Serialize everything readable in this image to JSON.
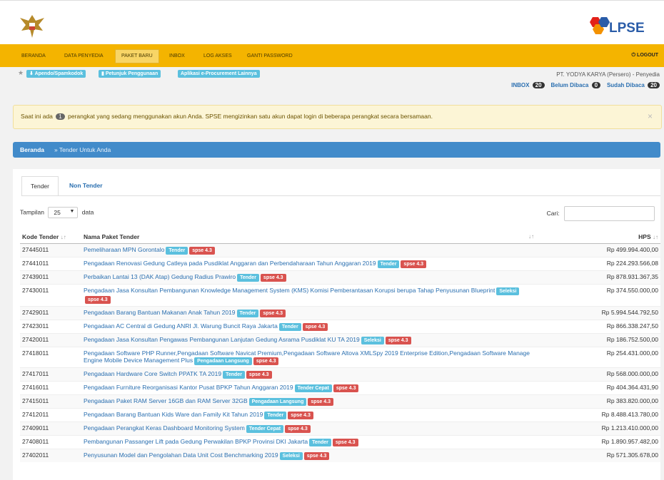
{
  "nav": {
    "items": [
      "Beranda",
      "Data Penyedia",
      "Paket Baru",
      "Inbox",
      "Log Akses",
      "Ganti Password"
    ],
    "logout": "LOGOUT"
  },
  "logo": {
    "text": "LPSE"
  },
  "toolbar": {
    "star": "★",
    "links": [
      "Apendo/Spamkodok",
      "Petunjuk Penggunaan",
      "Aplikasi e-Procurement Lainnya"
    ]
  },
  "user": {
    "company": "PT. YODYA KARYA (Persero) - Penyedia",
    "inbox_label": "INBOX",
    "inbox_count": "20",
    "unread_label": "Belum Dibaca",
    "unread_count": "0",
    "read_label": "Sudah Dibaca",
    "read_count": "20"
  },
  "alert": {
    "prefix": "Saat ini ada",
    "count": "1",
    "suffix": "perangkat yang sedang menggunakan akun Anda. SPSE mengizinkan satu akun dapat login di beberapa perangkat secara bersamaan.",
    "close": "×"
  },
  "breadcrumb": {
    "home": "Beranda",
    "current": "» Tender Untuk Anda"
  },
  "tabs": [
    "Tender",
    "Non Tender"
  ],
  "list": {
    "show_label": "Tampilan",
    "page_size": "25",
    "data_label": "data",
    "search_label": "Cari:",
    "search_value": ""
  },
  "table": {
    "columns": [
      "Kode Tender",
      "Nama Paket Tender",
      "HPS"
    ],
    "sort_glyph": "↓↑",
    "rows": [
      {
        "code": "27445011",
        "name": "Pemeliharaan MPN Gorontalo",
        "type": "Tender",
        "ver": "spse 4.3",
        "hps": "Rp 499.994.400,00"
      },
      {
        "code": "27441011",
        "name": "Pengadaan Renovasi Gedung Catleya pada Pusdiklat Anggaran dan Perbendaharaan Tahun Anggaran 2019",
        "type": "Tender",
        "ver": "spse 4.3",
        "hps": "Rp 224.293.566,08"
      },
      {
        "code": "27439011",
        "name": "Perbaikan Lantai 13 (DAK Atap) Gedung Radius Prawiro",
        "type": "Tender",
        "ver": "spse 4.3",
        "hps": "Rp 878.931.367,35"
      },
      {
        "code": "27430011",
        "name": "Pengadaan Jasa Konsultan Pembangunan Knowledge Management System (KMS) Komisi Pemberantasan Korupsi berupa Tahap Penyusunan Blueprint",
        "type": "Seleksi",
        "ver": "spse 4.3",
        "hps": "Rp 374.550.000,00"
      },
      {
        "code": "27429011",
        "name": "Pengadaan Barang Bantuan Makanan Anak Tahun 2019",
        "type": "Tender",
        "ver": "spse 4.3",
        "hps": "Rp 5.994.544.792,50"
      },
      {
        "code": "27423011",
        "name": "Pengadaan AC Central di Gedung ANRI Jl. Warung Buncit Raya Jakarta",
        "type": "Tender",
        "ver": "spse 4.3",
        "hps": "Rp 866.338.247,50"
      },
      {
        "code": "27420011",
        "name": "Pengadaan Jasa Konsultan Pengawas Pembangunan Lanjutan Gedung Asrama Pusdiklat KU TA 2019",
        "type": "Seleksi",
        "ver": "spse 4.3",
        "hps": "Rp 186.752.500,00"
      },
      {
        "code": "27418011",
        "name": "Pengadaan Software PHP Runner,Pengadaan Software Navicat Premium,Pengadaan Software Altova XMLSpy 2019 Enterprise Edition,Pengadaan Software Manage Engine Mobile Device Management Plus",
        "type": "Pengadaan Langsung",
        "ver": "spse 4.3",
        "hps": "Rp 254.431.000,00"
      },
      {
        "code": "27417011",
        "name": "Pengadaan Hardware Core Switch PPATK TA 2019",
        "type": "Tender",
        "ver": "spse 4.3",
        "hps": "Rp 568.000.000,00"
      },
      {
        "code": "27416011",
        "name": "Pengadaan Furniture Reorganisasi Kantor Pusat BPKP Tahun Anggaran 2019",
        "type": "Tender Cepat",
        "ver": "spse 4.3",
        "hps": "Rp 404.364.431,90"
      },
      {
        "code": "27415011",
        "name": "Pengadaan Paket RAM Server 16GB dan RAM Server 32GB",
        "type": "Pengadaan Langsung",
        "ver": "spse 4.3",
        "hps": "Rp 383.820.000,00"
      },
      {
        "code": "27412011",
        "name": "Pengadaan Barang Bantuan Kids Ware dan Family Kit Tahun 2019",
        "type": "Tender",
        "ver": "spse 4.3",
        "hps": "Rp 8.488.413.780,00"
      },
      {
        "code": "27409011",
        "name": "Pengadaan Perangkat Keras Dashboard Monitoring System",
        "type": "Tender Cepat",
        "ver": "spse 4.3",
        "hps": "Rp 1.213.410.000,00"
      },
      {
        "code": "27408011",
        "name": "Pembangunan Passanger Lift pada Gedung Perwakilan BPKP Provinsi DKI Jakarta",
        "type": "Tender",
        "ver": "spse 4.3",
        "hps": "Rp 1.890.957.482,00"
      },
      {
        "code": "27402011",
        "name": "Penyusunan Model dan Pengolahan Data Unit Cost Benchmarking 2019",
        "type": "Seleksi",
        "ver": "spse 4.3",
        "hps": "Rp 571.305.678,00"
      }
    ]
  },
  "colors": {
    "nav_bg": "#f4b400",
    "breadcrumb_bg": "#428bca",
    "type_badge": "#5bc0de",
    "version_badge": "#d9534f"
  }
}
